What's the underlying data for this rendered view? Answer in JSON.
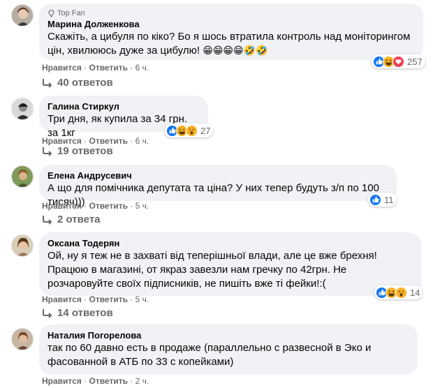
{
  "comments": [
    {
      "author": "Марина Долженкова",
      "badge": "Top Fan",
      "text": "Скажіть, а цибуля по кіко? Бо я шось втратила контроль над моніторингом цін, хвилююсь дуже за цибулю!",
      "emojis": "😁😁😁😁🤣🤣",
      "reaction_count": "257",
      "reaction_icons": [
        "like-icon",
        "haha-icon",
        "love-icon"
      ],
      "like_label": "Нравится",
      "reply_label": "Ответить",
      "time": "6 ч.",
      "replies": "40 ответов"
    },
    {
      "author": "Галина Стиркул",
      "text": "Три дня, як купила за 34 грн. за 1кг",
      "reaction_count": "27",
      "reaction_icons": [
        "like-icon",
        "haha-icon",
        "wow-icon"
      ],
      "like_label": "Нравится",
      "reply_label": "Ответить",
      "time": "6 ч.",
      "replies": "19 ответов"
    },
    {
      "author": "Елена Андрусевич",
      "text": "А що для помічника депутата та ціна? У них тепер будуть з/п по 100 тисяч)))",
      "reaction_count": "11",
      "reaction_icons": [
        "like-icon"
      ],
      "like_label": "Нравится",
      "reply_label": "Ответить",
      "time": "5 ч.",
      "replies": "2 ответа"
    },
    {
      "author": "Оксана Тодерян",
      "text": "Ой, ну я теж не в захваті від теперішньої влади, але це вже брехня! Працюю в магазині, от якраз завезли нам гречку по 42грн. Не розчаровуйте своїх підписників, не пишіть вже ті фейки!:(",
      "reaction_count": "14",
      "reaction_icons": [
        "like-icon",
        "haha-icon",
        "wow-icon"
      ],
      "like_label": "Нравится",
      "reply_label": "Ответить",
      "time": "5 ч.",
      "replies": "14 ответов"
    },
    {
      "author": "Наталия Погорелова",
      "text": "так по 60 давно есть в продаже (параллельно с развесной в Эко и фасованной в АТБ по 33 с копейками)",
      "like_label": "Нравится",
      "reply_label": "Ответить",
      "time": "2 ч."
    }
  ],
  "colors": {
    "bubble": "#f0f2f5",
    "meta": "#65676b",
    "like": "#1877f2"
  }
}
